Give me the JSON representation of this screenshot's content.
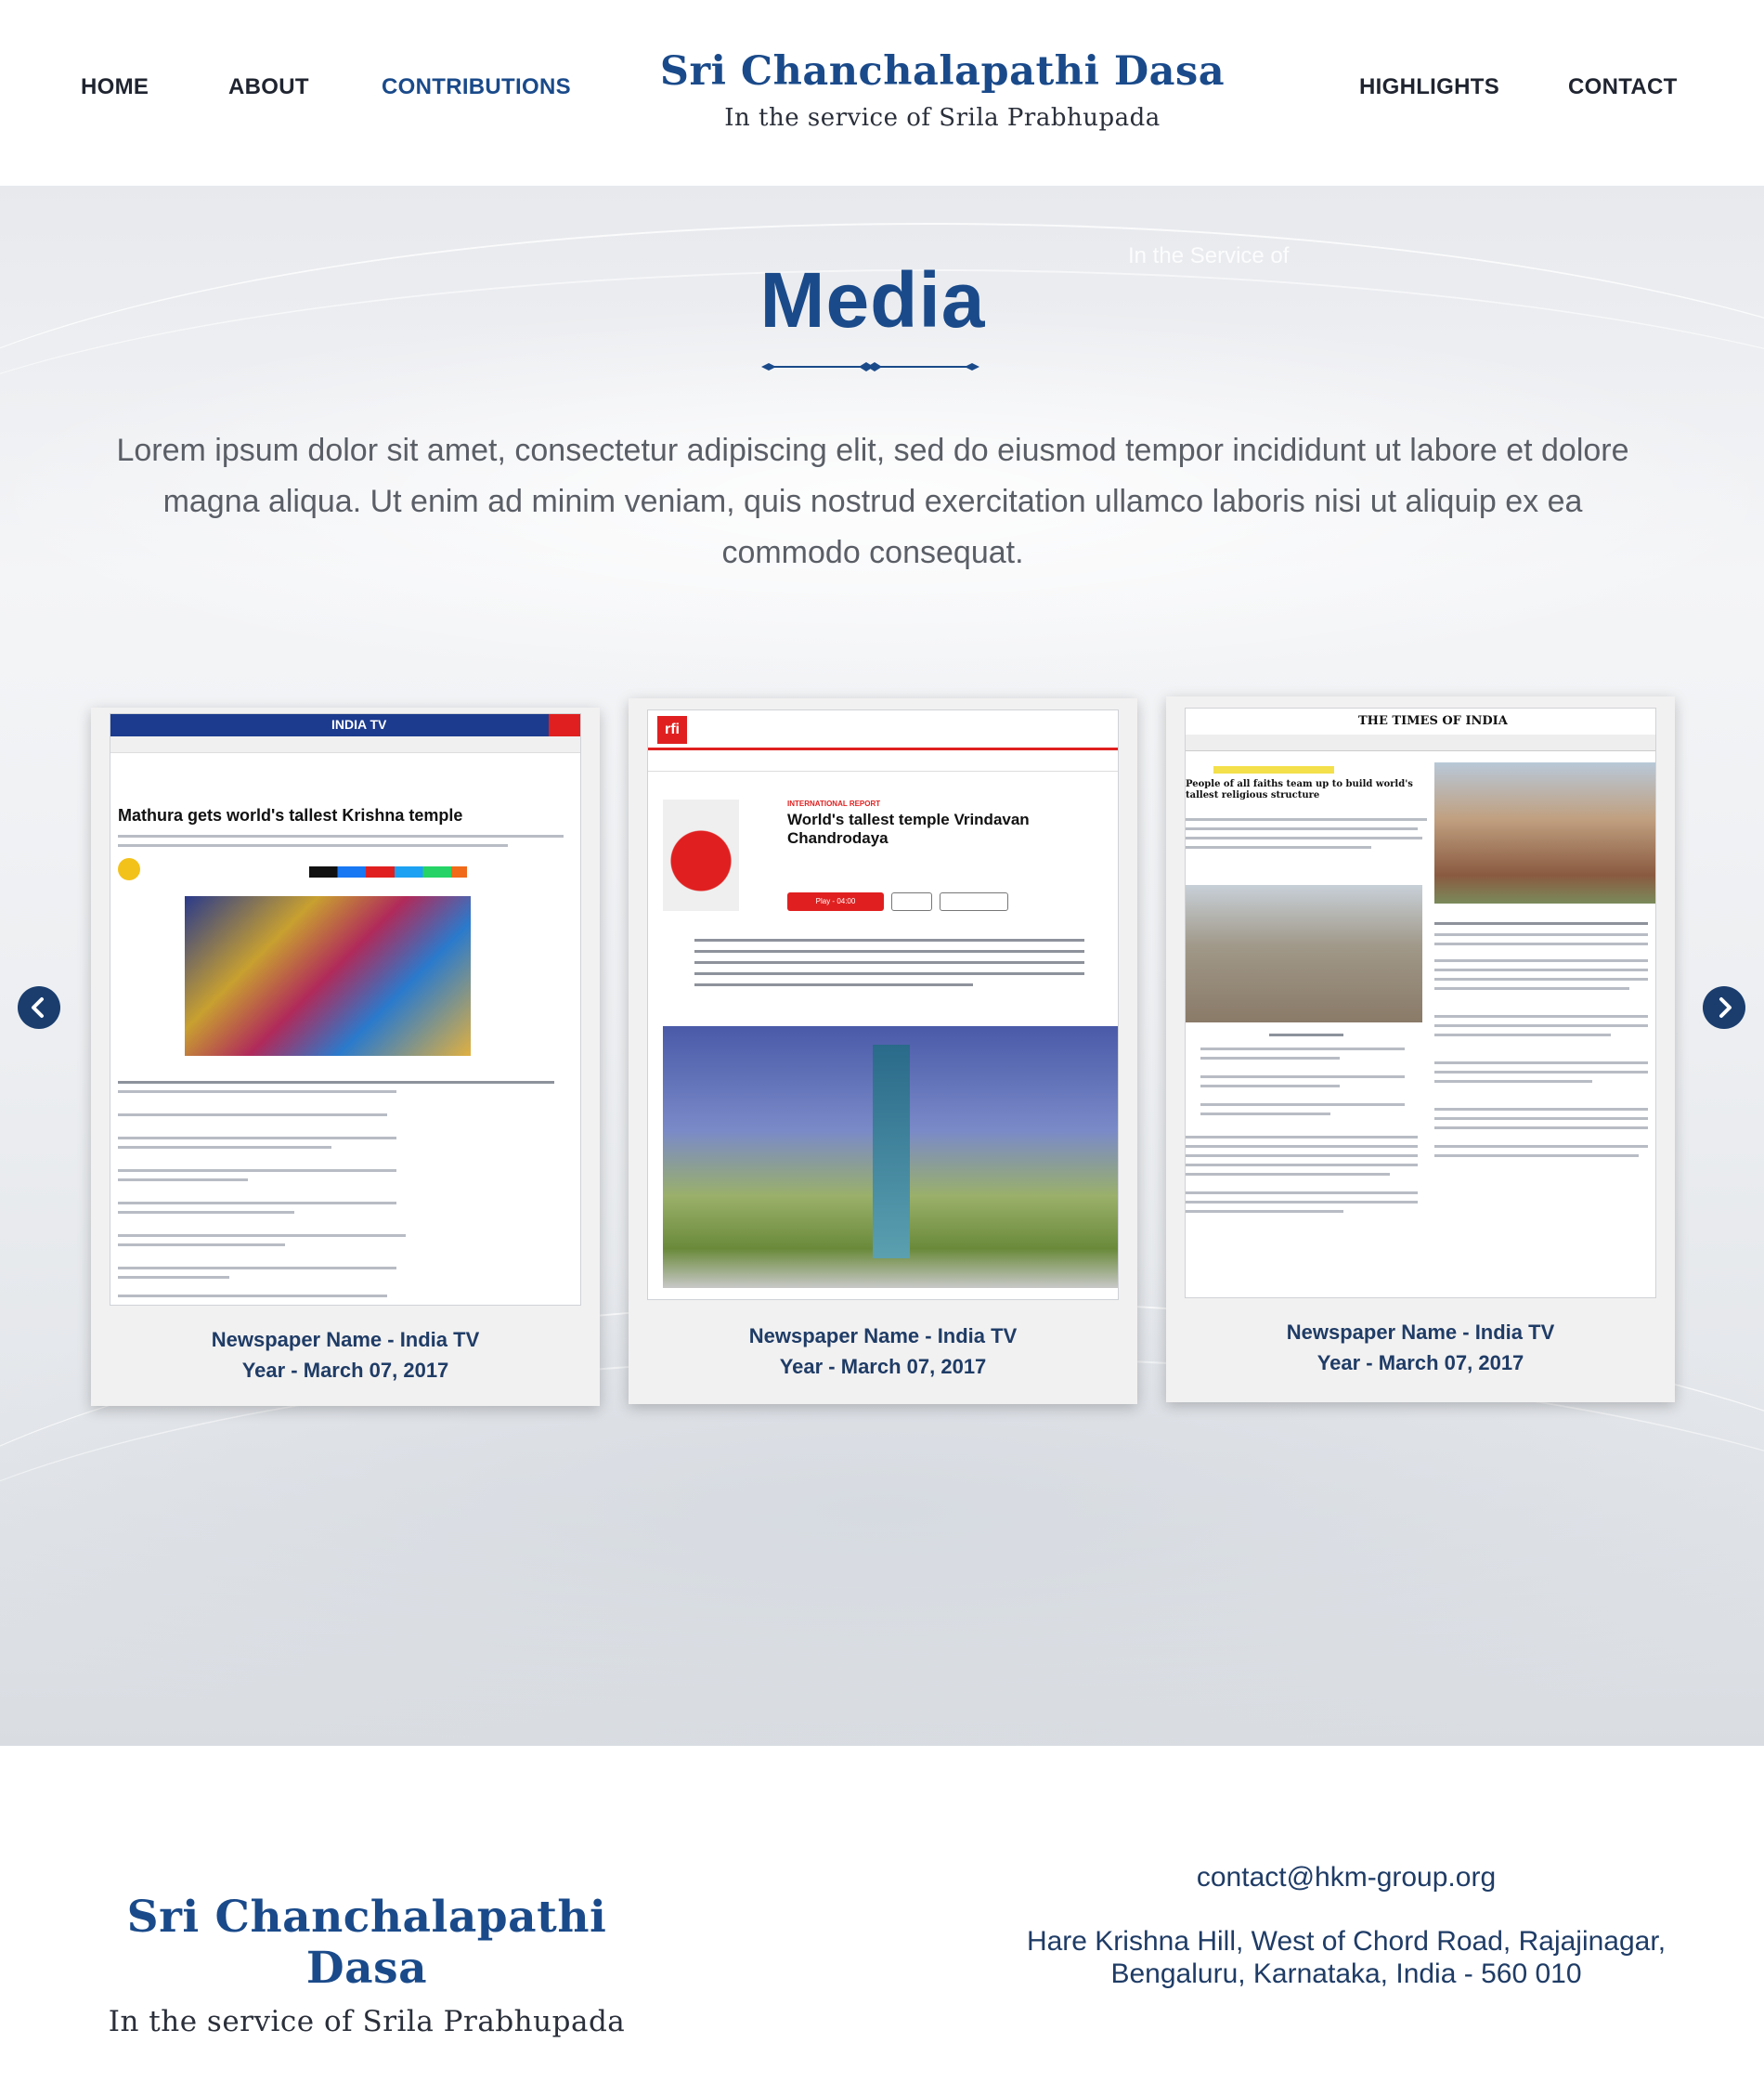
{
  "nav": {
    "home": "HOME",
    "about": "ABOUT",
    "contributions": "CONTRIBUTIONS",
    "highlights": "HIGHLIGHTS",
    "contact": "CONTACT"
  },
  "brand": {
    "title": "Sri Chanchalapathi Dasa",
    "subtitle": "In the service of Srila Prabhupada"
  },
  "hero": {
    "ghost": "In the Service of",
    "title": "Media",
    "text": "Lorem ipsum dolor sit amet, consectetur adipiscing elit, sed do eiusmod tempor incididunt ut labore et dolore magna aliqua. Ut enim ad minim veniam, quis nostrud exercitation ullamco laboris nisi ut aliquip ex ea commodo consequat."
  },
  "cards": [
    {
      "newspaper": "Newspaper Name - India TV",
      "year": "Year - March 07, 2017",
      "headline": "Mathura gets world's tallest Krishna temple",
      "masthead": "INDIA TV"
    },
    {
      "newspaper": "Newspaper Name - India TV",
      "year": "Year - March 07, 2017",
      "headline": "World's tallest temple Vrindavan Chandrodaya",
      "masthead": "rfi",
      "tag": "INTERNATIONAL REPORT",
      "play": "Play - 04:00"
    },
    {
      "newspaper": "Newspaper Name - India TV",
      "year": "Year - March 07, 2017",
      "headline": "People of all faiths team up to build world's tallest religious structure",
      "masthead": "THE TIMES OF INDIA"
    }
  ],
  "footer": {
    "title": "Sri Chanchalapathi Dasa",
    "subtitle": "In the service of Srila Prabhupada",
    "email": "contact@hkm-group.org",
    "address_line1": "Hare Krishna Hill, West of Chord Road, Rajajinagar,",
    "address_line2": "Bengaluru, Karnataka, India - 560 010"
  },
  "colors": {
    "brand_blue": "#1a4a8a",
    "caption_blue": "#1f3c66",
    "arrow_bg": "#1a3d6e"
  },
  "icons": {
    "prev": "chevron-left-icon",
    "next": "chevron-right-icon"
  }
}
